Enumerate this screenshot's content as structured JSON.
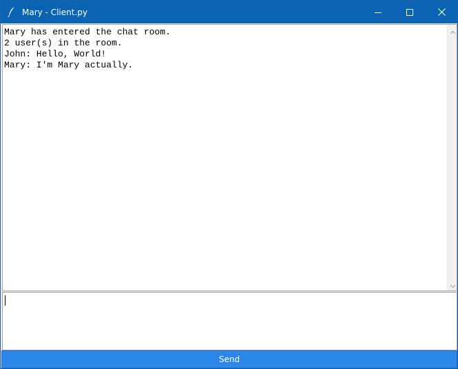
{
  "window": {
    "title": "Mary - Client.py",
    "icon": "feather-icon"
  },
  "titlebar_buttons": {
    "minimize": "minimize-icon",
    "maximize": "maximize-icon",
    "close": "close-icon"
  },
  "chat": {
    "lines": [
      "Mary has entered the chat room.",
      "2 user(s) in the room.",
      "John: Hello, World!",
      "Mary: I'm Mary actually."
    ]
  },
  "input": {
    "value": ""
  },
  "send": {
    "label": "Send"
  },
  "colors": {
    "titlebar": "#0a63b3",
    "send_button": "#2b87e8"
  }
}
